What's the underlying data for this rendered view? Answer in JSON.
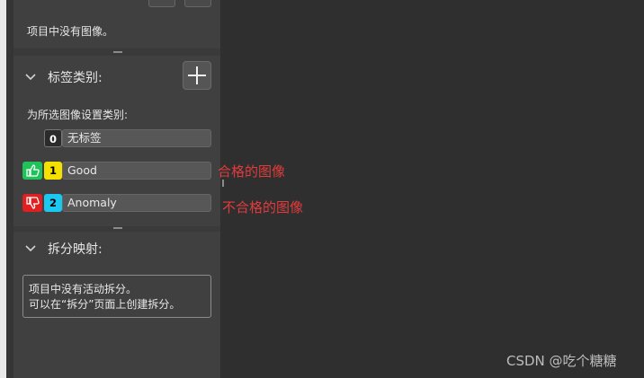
{
  "images_section": {
    "empty_text": "项目中没有图像。"
  },
  "labels_section": {
    "title": "标签类别:",
    "subtext": "为所选图像设置类别:",
    "items": [
      {
        "number": "0",
        "label": "无标签",
        "badge_color": "#2b2b2b",
        "number_color": "#ffffff"
      },
      {
        "number": "1",
        "label": "Good",
        "badge_color": "#f5e100",
        "number_color": "#000000",
        "icon": "thumbs-up-icon",
        "icon_color": "#20c25a"
      },
      {
        "number": "2",
        "label": "Anomaly",
        "badge_color": "#1cc8f0",
        "number_color": "#000000",
        "icon": "thumbs-down-icon",
        "icon_color": "#e02020"
      }
    ]
  },
  "splits_section": {
    "title": "拆分映射:",
    "message_line1": "项目中没有活动拆分。",
    "message_line2": "可以在“拆分”页面上创建拆分。"
  },
  "annotations": {
    "good": "合格的图像",
    "anomaly": "不合格的图像"
  },
  "watermark": "CSDN @吃个糖糖"
}
